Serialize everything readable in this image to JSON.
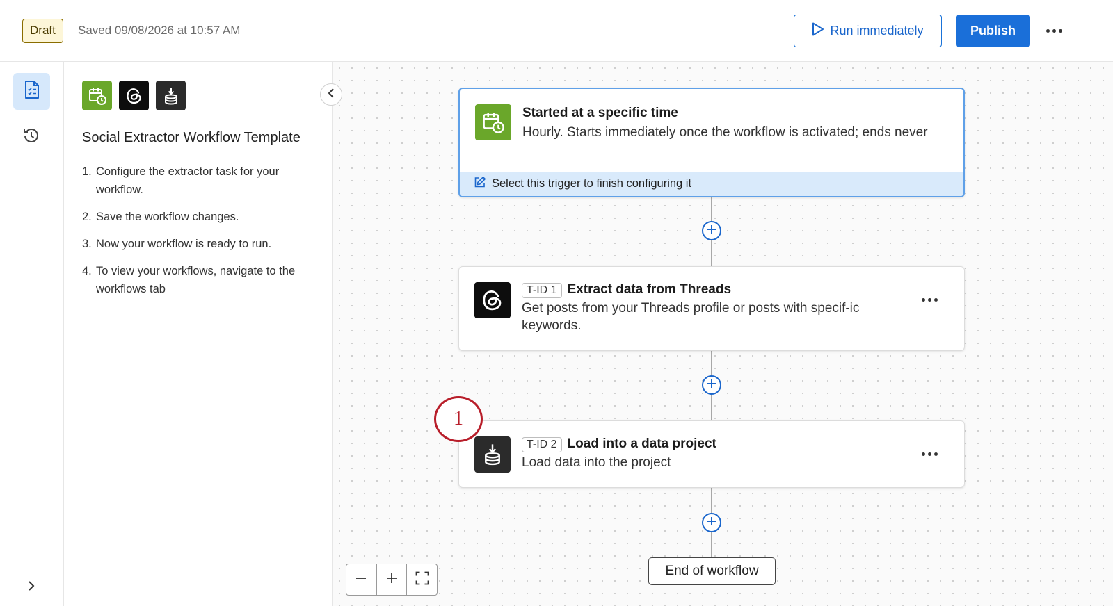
{
  "header": {
    "status_badge": "Draft",
    "saved_text": "Saved 09/08/2026 at 10:57 AM",
    "run_label": "Run immediately",
    "publish_label": "Publish",
    "accent_color": "#1a6fd9"
  },
  "rail": {
    "items": [
      {
        "icon": "document-icon",
        "active": true
      },
      {
        "icon": "history-icon",
        "active": false
      }
    ],
    "expand_icon": "chevron-right-icon"
  },
  "panel": {
    "app_icons": [
      "schedule-calendar-icon",
      "threads-icon",
      "data-load-icon"
    ],
    "title": "Social Extractor Workflow Template",
    "steps": [
      {
        "num": "1.",
        "text": "Configure the extractor task for your workflow."
      },
      {
        "num": "2.",
        "text": "Save the workflow changes."
      },
      {
        "num": "3.",
        "text": "Now your workflow is ready to run."
      },
      {
        "num": "4.",
        "text": "To view your workflows, navigate to the workflows tab"
      }
    ]
  },
  "workflow": {
    "trigger": {
      "icon": "schedule-calendar-icon",
      "title": "Started at a specific time",
      "description": "Hourly. Starts immediately once the workflow is activated; ends never",
      "footer": "Select this trigger to finish configuring it"
    },
    "tasks": [
      {
        "icon": "threads-icon",
        "tid": "T-ID 1",
        "title": "Extract data from Threads",
        "description": "Get posts from your Threads profile or posts with specif-ic keywords."
      },
      {
        "icon": "data-load-icon",
        "tid": "T-ID 2",
        "title": "Load into a data project",
        "description": "Load data into the project"
      }
    ],
    "step_marker": "1",
    "end_label": "End of workflow"
  },
  "zoom": {
    "out": "−",
    "in": "+"
  }
}
